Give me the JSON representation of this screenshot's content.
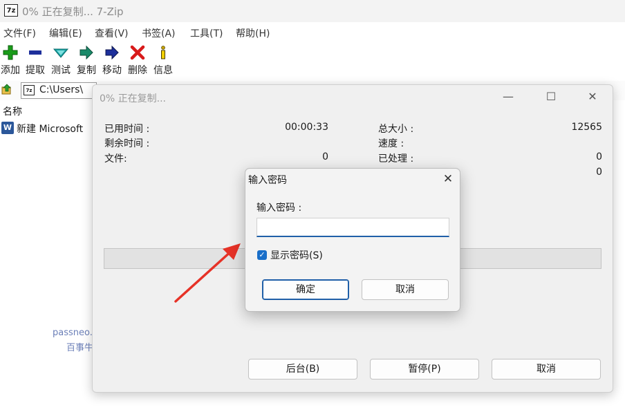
{
  "window": {
    "title": "0% 正在复制... 7-Zip",
    "logo": "7z"
  },
  "menu": [
    "文件(F)",
    "编辑(E)",
    "查看(V)",
    "书签(A)",
    "工具(T)",
    "帮助(H)"
  ],
  "toolbar": [
    {
      "label": "添加",
      "icon": "plus-icon",
      "color": "#1a9c1a"
    },
    {
      "label": "提取",
      "icon": "minus-icon",
      "color": "#1d2f9b"
    },
    {
      "label": "测试",
      "icon": "check-icon",
      "color": "#18a3a3"
    },
    {
      "label": "复制",
      "icon": "copy-arrow-icon",
      "color": "#1a8a6a"
    },
    {
      "label": "移动",
      "icon": "move-arrow-icon",
      "color": "#1d2f9b"
    },
    {
      "label": "删除",
      "icon": "delete-x-icon",
      "color": "#d81a1a"
    },
    {
      "label": "信息",
      "icon": "info-icon",
      "color": "#c9a400"
    }
  ],
  "address": {
    "path": "C:\\Users\\"
  },
  "file_list": {
    "column_name": "名称",
    "files": [
      {
        "name": "新建 Microsoft",
        "icon": "word-doc-icon"
      }
    ]
  },
  "progress_window": {
    "title": "0% 正在复制...",
    "controls": {
      "minimize": "—",
      "maximize": "☐",
      "close": "✕"
    },
    "left_stats": [
      {
        "label": "已用时间 :",
        "value": "00:00:33"
      },
      {
        "label": "剩余时间 :",
        "value": ""
      },
      {
        "label": "文件:",
        "value": "0"
      }
    ],
    "right_stats": [
      {
        "label": "总大小 :",
        "value": "12565"
      },
      {
        "label": "速度 :",
        "value": ""
      },
      {
        "label": "已处理 :",
        "value": "0"
      },
      {
        "label": "",
        "value": "0"
      }
    ],
    "progress": 0,
    "progress_color": "#06b025",
    "buttons": {
      "background": "后台(B)",
      "pause": "暂停(P)",
      "cancel": "取消"
    }
  },
  "password_dialog": {
    "title": "输入密码",
    "close": "✕",
    "field_label": "输入密码 :",
    "field_value": "",
    "show_password": {
      "label": "显示密码(S)",
      "checked": true
    },
    "buttons": {
      "ok": "确定",
      "cancel": "取消"
    },
    "accent": "#1f5fa8"
  },
  "watermark": {
    "line1": "passneo.cn",
    "line2": "百事牛"
  },
  "annotation_color": "#e63227"
}
